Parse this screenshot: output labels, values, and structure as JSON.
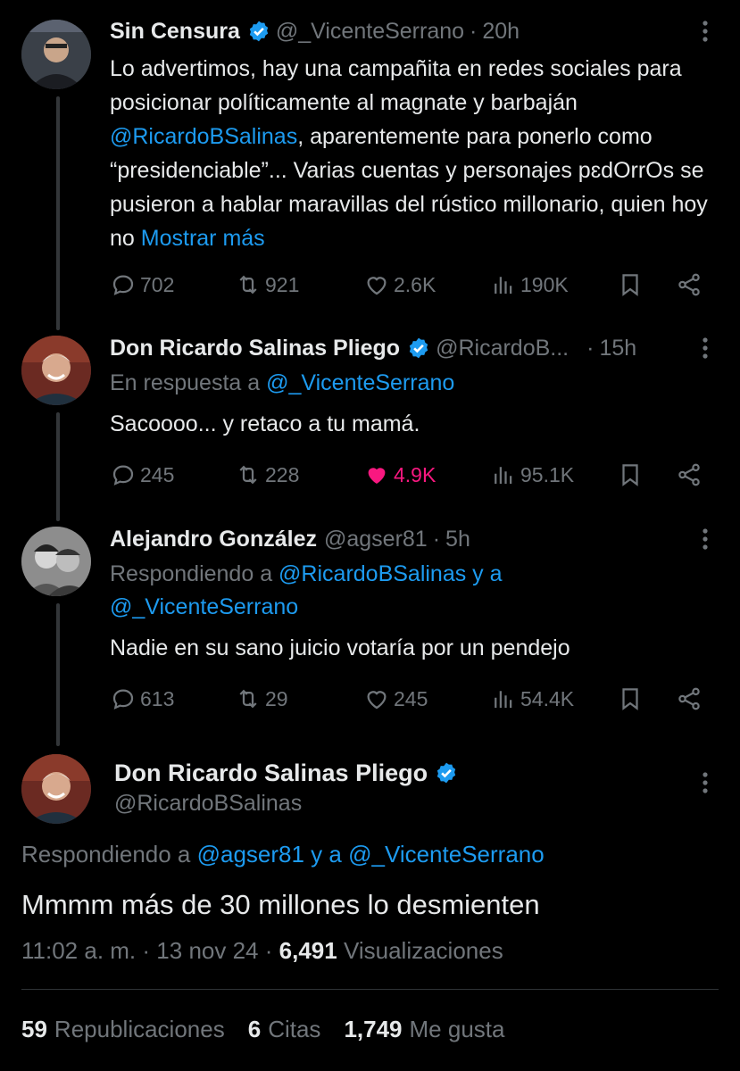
{
  "tweets": [
    {
      "name": "Sin Censura",
      "handle": "@_VicenteSerrano",
      "dot": "·",
      "time": "20h",
      "text_before": "Lo advertimos, hay una campañita en redes sociales para posicionar políticamente al magnate y barbaján ",
      "mention": "@RicardoBSalinas",
      "text_after": ", aparentemente para ponerlo como “presidenciable”... Varias cuentas y personajes pɛdOrrOs se pusieron a hablar maravillas del rústico millonario, quien hoy no ",
      "show_more": "Mostrar más",
      "replies": "702",
      "retweets": "921",
      "likes": "2.6K",
      "views": "190K"
    },
    {
      "name": "Don Ricardo Salinas Pliego",
      "handle": "@RicardoB...",
      "dot": "·",
      "time": "15h",
      "reply_prefix": "En respuesta a ",
      "reply_mention": "@_VicenteSerrano",
      "text": "Sacoooo... y retaco a tu mamá.",
      "replies": "245",
      "retweets": "228",
      "likes": "4.9K",
      "views": "95.1K"
    },
    {
      "name": "Alejandro González",
      "handle": "@agser81",
      "dot": "·",
      "time": "5h",
      "reply_prefix": "Respondiendo a ",
      "reply_mention_1": "@RicardoBSalinas y a",
      "reply_mention_2": "@_VicenteSerrano",
      "text": "Nadie en su sano juicio votaría por un pendejo",
      "replies": "613",
      "retweets": "29",
      "likes": "245",
      "views": "54.4K"
    }
  ],
  "main": {
    "name": "Don Ricardo Salinas Pliego",
    "handle": "@RicardoBSalinas",
    "reply_prefix": "Respondiendo a ",
    "reply_mentions": "@agser81 y a @_VicenteSerrano",
    "text": "Mmmm más de 30 millones lo desmienten",
    "time": "11:02 a. m.",
    "dot1": "·",
    "date": "13 nov 24",
    "dot2": "·",
    "views_count": "6,491",
    "views_label": "Visualizaciones",
    "reposts_count": "59",
    "reposts_label": "Republicaciones",
    "quotes_count": "6",
    "quotes_label": "Citas",
    "likes_count": "1,749",
    "likes_label": "Me gusta"
  },
  "colors": {
    "background": "#000000",
    "link": "#1d9bf0",
    "like": "#f91880",
    "muted": "#71767b",
    "text": "#e7e9ea"
  },
  "icons": [
    "verified-badge-icon",
    "more-options-icon",
    "reply-icon",
    "retweet-icon",
    "like-icon",
    "views-icon",
    "bookmark-icon",
    "share-icon"
  ]
}
